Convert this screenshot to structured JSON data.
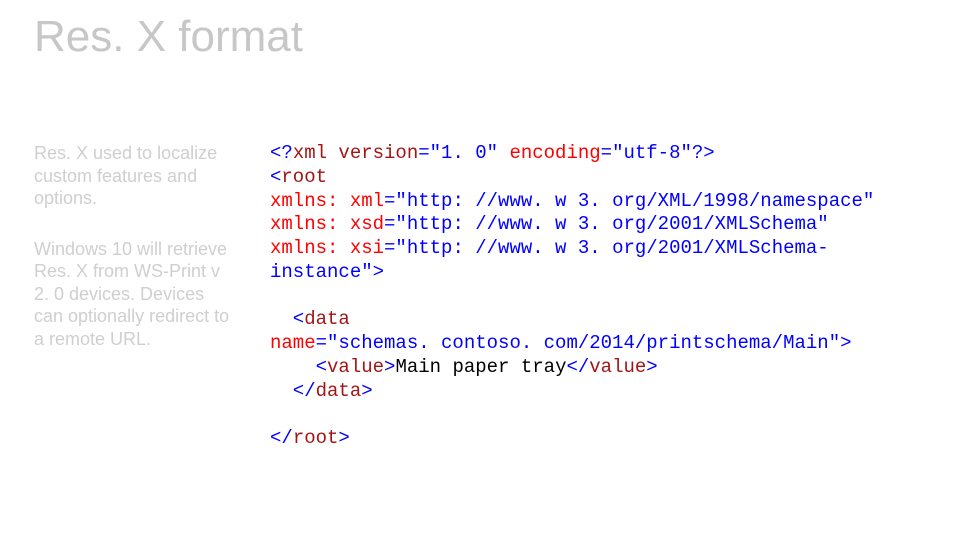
{
  "title": "Res. X format",
  "left": {
    "p1": "Res. X used to localize custom features and options.",
    "p2": "Windows 10 will retrieve Res. X from WS-Print v 2. 0 devices. Devices can optionally redirect to a remote URL."
  },
  "code": {
    "l1_a": "<?",
    "l1_b": "xml version",
    "l1_c": "=\"1. 0\" ",
    "l1_d": "encoding",
    "l1_e": "=\"utf-8\"?",
    "l1_f": ">",
    "l2_a": "<",
    "l2_b": "root",
    "l3_a": "xmlns: xml",
    "l3_b": "=\"http: //www. w 3. org/XML/1998/namespace\"",
    "l4_a": "xmlns: xsd",
    "l4_b": "=\"http: //www. w 3. org/2001/XMLSchema\"",
    "l5_a": "xmlns: xsi",
    "l5_b": "=\"http: //www. w 3. org/2001/XMLSchema-",
    "l6_a": "instance\"",
    "l6_b": ">",
    "blank1": "",
    "l8_a": "  <",
    "l8_b": "data",
    "l9_a": "name",
    "l9_b": "=\"schemas. contoso. com/2014/printschema/Main\"",
    "l9_c": ">",
    "l10_a": "    <",
    "l10_b": "value",
    "l10_c": ">",
    "l10_d": "Main paper tray",
    "l10_e": "</",
    "l10_f": "value",
    "l10_g": ">",
    "l11_a": "  </",
    "l11_b": "data",
    "l11_c": ">",
    "blank2": "",
    "l13_a": "</",
    "l13_b": "root",
    "l13_c": ">"
  }
}
